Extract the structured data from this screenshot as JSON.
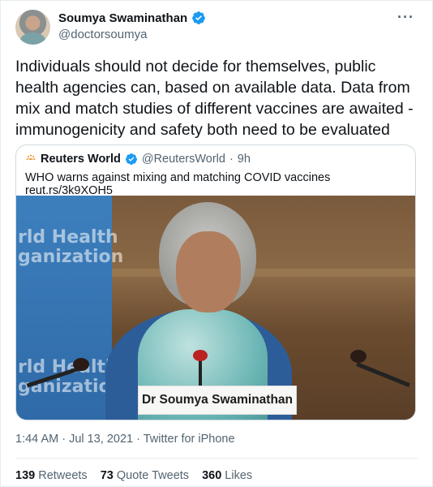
{
  "author": {
    "display_name": "Soumya Swaminathan",
    "handle": "@doctorsoumya",
    "verified": true,
    "verified_color": "#1d9bf0"
  },
  "more_icon": "more-horizontal-icon",
  "tweet_text": "Individuals should not decide for themselves, public health agencies can, based on available data. Data from mix and match studies of different vaccines are awaited - immunogenicity and safety both need to be evaluated",
  "quote": {
    "display_name": "Reuters World",
    "handle": "@ReutersWorld",
    "separator": "·",
    "time": "9h",
    "text": "WHO warns against mixing and matching COVID vaccines reut.rs/3k9XOH5",
    "image": {
      "banner_text_1": "rld Health\nganization",
      "banner_text_2": "rld Health\nganization",
      "nameplate": "Dr Soumya Swaminathan"
    }
  },
  "timestamp": "1:44 AM · Jul 13, 2021 · Twitter for iPhone",
  "stats": {
    "retweets_count": "139",
    "retweets_label": "Retweets",
    "quotes_count": "73",
    "quotes_label": "Quote Tweets",
    "likes_count": "360",
    "likes_label": "Likes"
  }
}
